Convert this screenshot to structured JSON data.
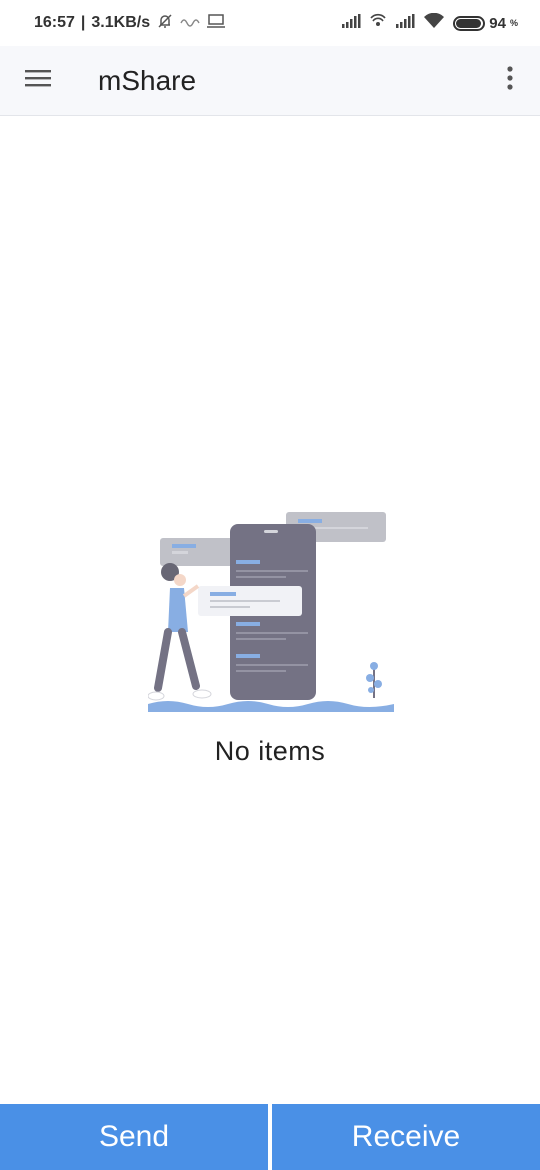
{
  "status_bar": {
    "time": "16:57",
    "network_speed": "3.1KB/s",
    "battery_level": "94",
    "battery_unit": "%",
    "icons": [
      "mute-bell-icon",
      "signal-wave-icon",
      "laptop-icon",
      "cell-signal-icon",
      "hotspot-icon",
      "cell-signal-icon",
      "wifi-icon",
      "battery-icon"
    ]
  },
  "app_bar": {
    "title": "mShare",
    "menu_icon": "hamburger-menu-icon",
    "more_icon": "more-vertical-icon"
  },
  "main": {
    "empty_state_text": "No items",
    "illustration": "empty-state-illustration"
  },
  "bottom_bar": {
    "send_label": "Send",
    "receive_label": "Receive",
    "button_color": "#4a90e6"
  }
}
